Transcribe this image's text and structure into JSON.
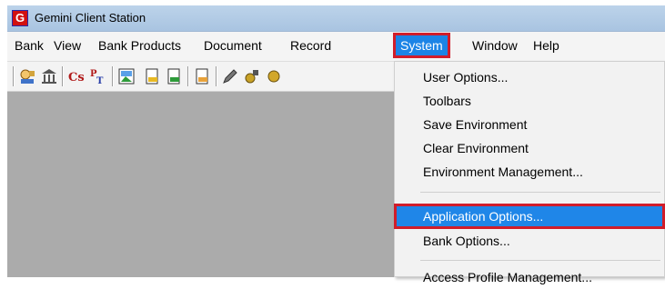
{
  "window": {
    "title": "Gemini Client Station",
    "icon_letter": "G"
  },
  "menubar": {
    "items": [
      {
        "label": "Bank"
      },
      {
        "label": "View"
      },
      {
        "label": "Bank Products"
      },
      {
        "label": "Document"
      },
      {
        "label": "Record"
      },
      {
        "label": "System",
        "active": true
      },
      {
        "label": "Window"
      },
      {
        "label": "Help"
      }
    ]
  },
  "toolbar": {
    "icons": [
      "user-bank-icon",
      "bank-building-icon",
      "cs-icon",
      "pt-icon",
      "image-icon",
      "document-out-icon",
      "document-in-icon",
      "document-temp-icon",
      "edit-icon",
      "tools-icon",
      "gear-icon"
    ]
  },
  "system_menu": {
    "items": [
      {
        "label": "User Options..."
      },
      {
        "label": "Toolbars"
      },
      {
        "label": "Save Environment"
      },
      {
        "label": "Clear Environment"
      },
      {
        "label": "Environment Management..."
      },
      {
        "label": "Application Options...",
        "highlighted": true
      },
      {
        "label": "Bank Options..."
      },
      {
        "label": "Access Profile Management..."
      }
    ]
  },
  "colors": {
    "titlebar": "#b3cce6",
    "menu_highlight": "#1f86e8",
    "annotation_outline": "#d11d2a",
    "workspace": "#ababab"
  }
}
